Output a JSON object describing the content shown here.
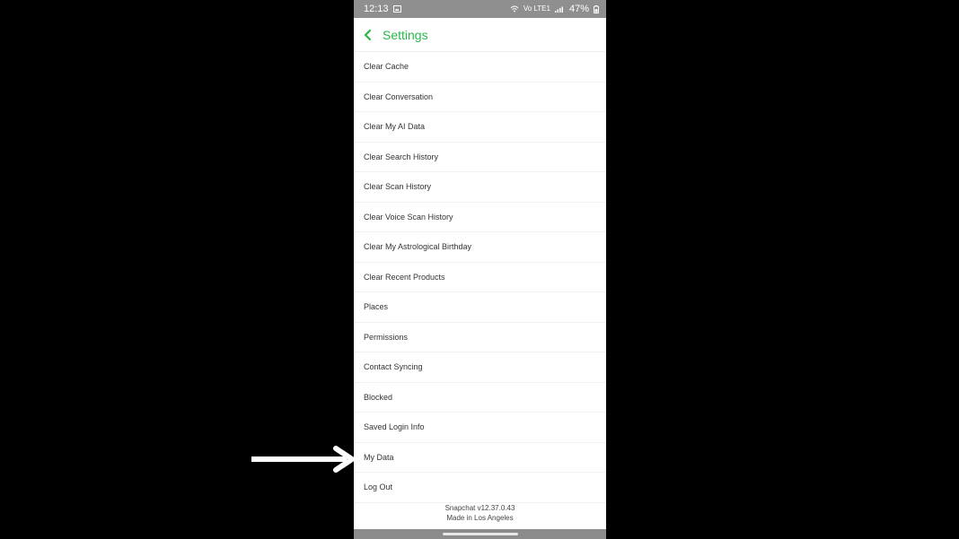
{
  "status_bar": {
    "time": "12:13",
    "network": "Vo LTE1",
    "battery": "47%"
  },
  "header": {
    "title": "Settings",
    "back_icon": "chevron-left-icon"
  },
  "settings_items": [
    "Clear Cache",
    "Clear Conversation",
    "Clear My AI Data",
    "Clear Search History",
    "Clear Scan History",
    "Clear Voice Scan History",
    "Clear My Astrological Birthday",
    "Clear Recent Products",
    "Places",
    "Permissions",
    "Contact Syncing",
    "Blocked",
    "Saved Login Info",
    "My Data",
    "Log Out"
  ],
  "footer": {
    "version": "Snapchat v12.37.0.43",
    "made_in": "Made in Los Angeles"
  },
  "colors": {
    "accent": "#2bb94a",
    "arrow": "#ffffff",
    "background": "#000000"
  },
  "annotation": {
    "icon": "right-arrow-icon",
    "target_label": "My Data"
  }
}
